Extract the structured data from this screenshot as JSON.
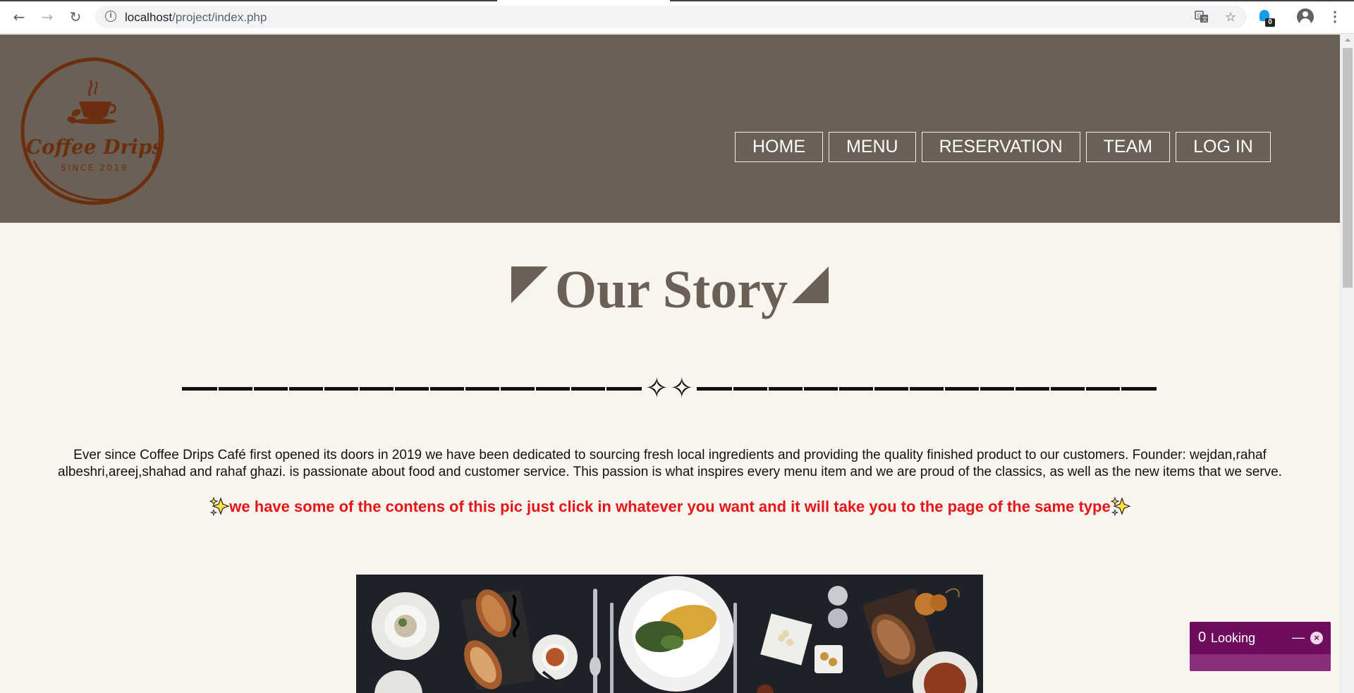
{
  "browser": {
    "url_host": "localhost",
    "url_path": "/project/index.php",
    "translate_icon": "translate-icon",
    "bookmark_icon": "star-icon",
    "extension_badge": "0"
  },
  "logo": {
    "name": "Coffee Drips",
    "tagline": "SINCE 2019"
  },
  "nav": {
    "items": [
      "HOME",
      "MENU",
      "RESERVATION",
      "TEAM",
      "LOG IN"
    ]
  },
  "story": {
    "title": "Our Story",
    "divider_symbol": "✧✧",
    "text": "Ever since Coffee Drips Café first opened its doors in 2019 we have been dedicated to sourcing fresh local ingredients and providing the quality finished product to our customers. Founder: wejdan,rahaf albeshri,areej,shahad and rahaf ghazi. is passionate about food and customer service. This passion is what inspires every menu item and we are proud of the classics, as well as the new items that we serve.",
    "hint": "we have some of the contens of this pic just click in whatever you want and it will take you to the page of the same type"
  },
  "chat": {
    "count": "0",
    "label": "Looking",
    "minimize": "—",
    "close": "×"
  },
  "colors": {
    "header_bg": "#6b6055",
    "page_bg": "#f8f4ee",
    "logo_brown": "#6b2e0e",
    "hint_red": "#e8141a",
    "chat_purple": "#6e0d5e"
  }
}
